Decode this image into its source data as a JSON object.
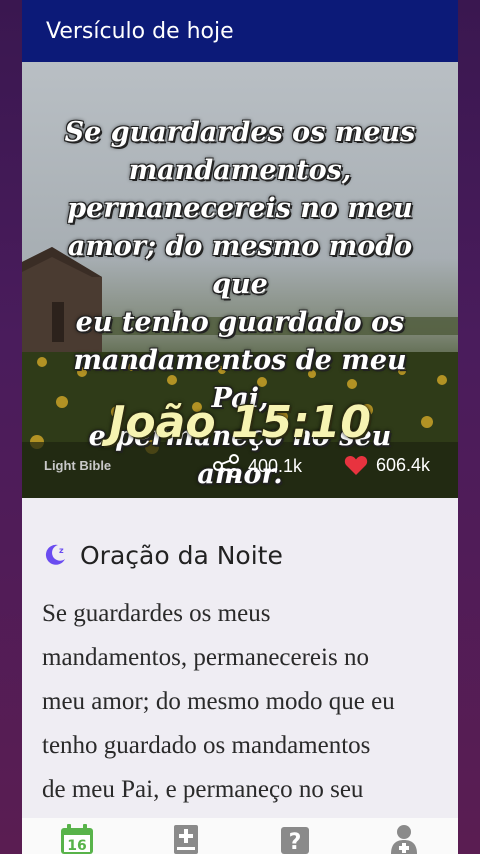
{
  "appbar": {
    "title": "Versículo de hoje"
  },
  "hero": {
    "verse_lines": [
      "Se guardardes os meus",
      "mandamentos,",
      "permanecereis no meu",
      "amor; do mesmo modo que",
      "eu tenho guardado os",
      "mandamentos de meu Pai,",
      "e permaneço no seu amor."
    ],
    "reference": "João 15:10",
    "brand": "Light Bible",
    "shares": "400.1k",
    "likes": "606.4k"
  },
  "prayer": {
    "title": "Oração da Noite",
    "text_lines": [
      "Se guardardes os meus",
      "mandamentos, permanecereis no",
      "meu amor; do mesmo modo que eu",
      "tenho guardado os mandamentos",
      "de meu Pai, e permaneço no seu"
    ]
  },
  "navbar": {
    "calendar_day": "16",
    "items": [
      "calendar-icon",
      "bible-add-icon",
      "question-icon",
      "add-user-icon"
    ]
  },
  "colors": {
    "appbar": "#0c1a78",
    "accent": "#6a4cf0",
    "heart": "#e8333f",
    "nav_green": "#58b34a"
  }
}
